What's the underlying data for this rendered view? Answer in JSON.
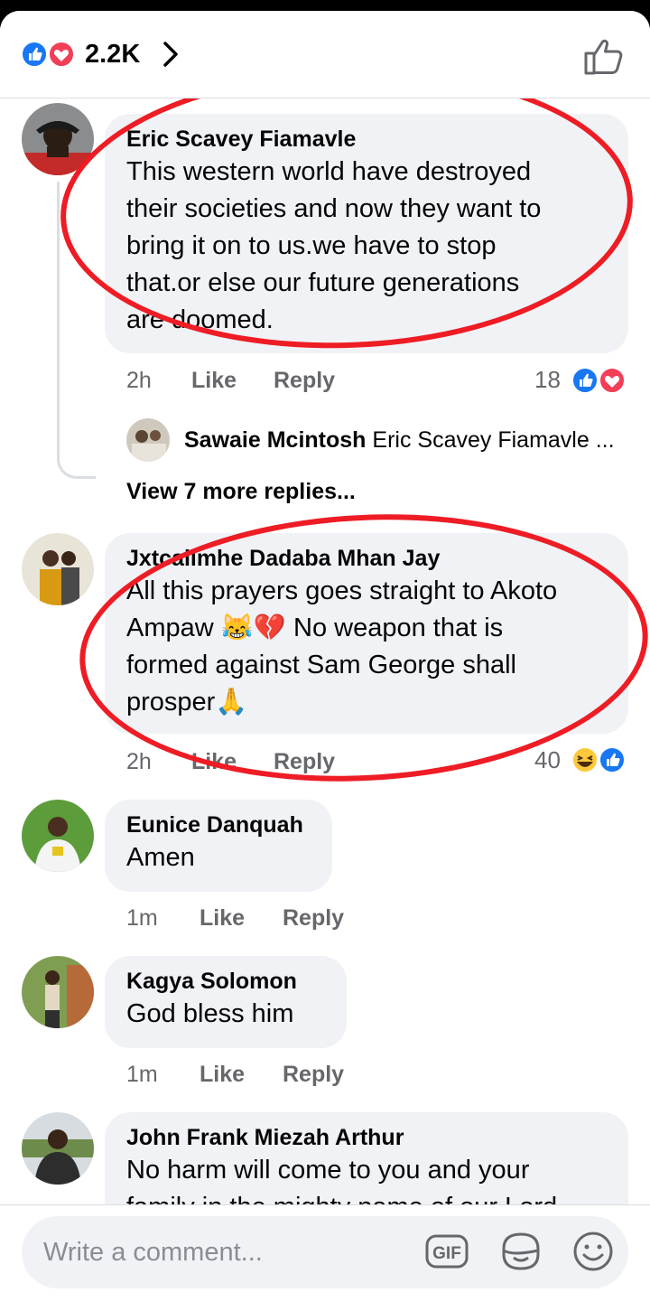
{
  "header": {
    "reaction_count": "2.2K"
  },
  "comments": [
    {
      "name": "Eric Scavey Fiamavle",
      "text_lines": [
        "This western world have destroyed",
        "their societies and now they want to",
        "bring it on to us.we have to stop",
        "that.or else our future generations",
        "are doomed."
      ],
      "time": "2h",
      "like": "Like",
      "reply": "Reply",
      "reactions": "18",
      "replies": {
        "name": "Sawaie Mcintosh",
        "preview": "Eric Scavey Fiamavle ...",
        "view_more": "View 7 more replies..."
      }
    },
    {
      "name": "Jxtcallmhe Dadaba Mhan Jay",
      "text_lines": [
        "All this prayers goes straight to Akoto",
        "Ampaw 😹💔 No weapon that is",
        "formed against Sam George shall",
        "prosper🙏"
      ],
      "time": "2h",
      "like": "Like",
      "reply": "Reply",
      "reactions": "40"
    },
    {
      "name": "Eunice Danquah",
      "text": "Amen",
      "time": "1m",
      "like": "Like",
      "reply": "Reply"
    },
    {
      "name": "Kagya Solomon",
      "text": "God bless him",
      "time": "1m",
      "like": "Like",
      "reply": "Reply"
    },
    {
      "name": "John Frank Miezah Arthur",
      "text_lines": [
        "No harm will come to you and your",
        "family in the mighty name of our Lord"
      ]
    }
  ],
  "composer": {
    "placeholder": "Write a comment..."
  },
  "colors": {
    "like_blue": "#1877f2",
    "love_red": "#f33e58",
    "annotation_red": "#ee1c24"
  }
}
